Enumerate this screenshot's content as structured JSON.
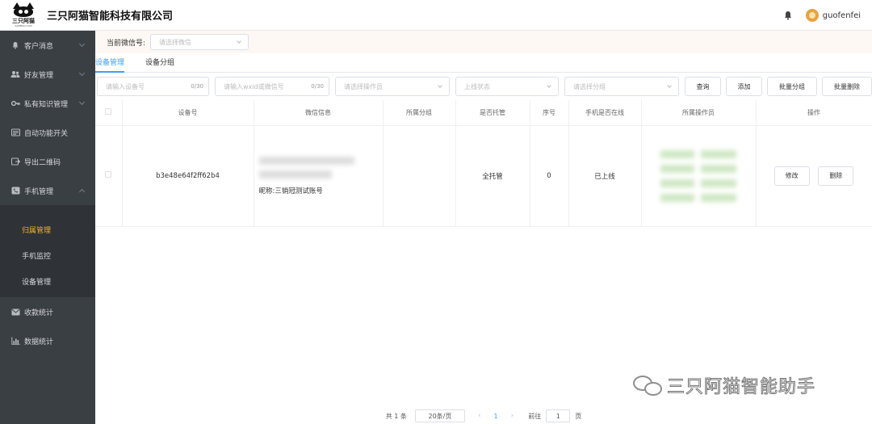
{
  "header": {
    "logo_text": "三只阿猫",
    "logo_sub": "SANMAO.COM",
    "company": "三只阿猫智能科技有限公司",
    "username": "guofenfei"
  },
  "sidebar": {
    "items": [
      {
        "label": "客户消息",
        "icon": "bell-icon"
      },
      {
        "label": "好友管理",
        "icon": "users-icon"
      },
      {
        "label": "私有知识管理",
        "icon": "key-icon"
      },
      {
        "label": "自动功能开关",
        "icon": "list-icon"
      },
      {
        "label": "导出二维码",
        "icon": "export-icon"
      },
      {
        "label": "手机管理",
        "icon": "phone-icon"
      }
    ],
    "sub_items": [
      {
        "label": "归属管理",
        "active": true
      },
      {
        "label": "手机监控",
        "active": false
      },
      {
        "label": "设备管理",
        "active": false
      }
    ],
    "bottom_items": [
      {
        "label": "收款统计",
        "icon": "mail-icon"
      },
      {
        "label": "数据统计",
        "icon": "chart-icon"
      }
    ]
  },
  "wechat_select": {
    "label": "当前微信号:",
    "placeholder": "请选择微信"
  },
  "tabs": [
    {
      "label": "设备管理",
      "active": true
    },
    {
      "label": "设备分组",
      "active": false
    }
  ],
  "filters": {
    "device_no_placeholder": "请输入设备号",
    "device_no_count": "0/30",
    "wxid_placeholder": "请输入wxid或微信号",
    "wxid_count": "0/30",
    "operator_placeholder": "请选择操作员",
    "status_placeholder": "上线状态",
    "group_placeholder": "请选择分组",
    "search_btn": "查询",
    "add_btn": "添加",
    "batch_group_btn": "批量分组",
    "batch_delete_btn": "批量删除"
  },
  "table": {
    "columns": [
      "设备号",
      "微信信息",
      "所属分组",
      "是否托管",
      "序号",
      "手机是否在线",
      "所属操作员",
      "操作"
    ],
    "rows": [
      {
        "device_no": "b3e48e64f2ff62b4",
        "wx_nickname": "昵称:三销冠测试账号",
        "group": "",
        "hosted": "全托管",
        "seq": "0",
        "online": "已上线",
        "edit_btn": "修改",
        "delete_btn": "删除"
      }
    ]
  },
  "pager": {
    "total": "共 1 条",
    "page_size": "20条/页",
    "prev": "‹",
    "current": "1",
    "next": "›",
    "goto_label": "前往",
    "goto_value": "1",
    "page_unit": "页"
  },
  "watermark": {
    "text": "三只阿猫智能助手"
  }
}
